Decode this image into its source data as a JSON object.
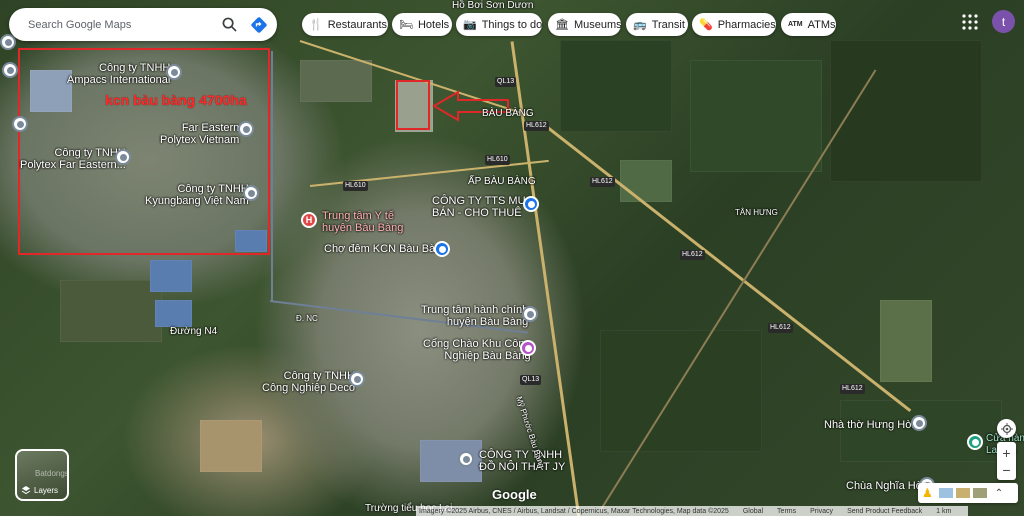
{
  "search": {
    "placeholder": "Search Google Maps"
  },
  "chips": [
    {
      "label": "Restaurants",
      "icon": "fork-knife-icon",
      "glyph": "🍴"
    },
    {
      "label": "Hotels",
      "icon": "bed-icon",
      "glyph": "🛏"
    },
    {
      "label": "Things to do",
      "icon": "camera-icon",
      "glyph": "📷"
    },
    {
      "label": "Museums",
      "icon": "museum-icon",
      "glyph": "🏛"
    },
    {
      "label": "Transit",
      "icon": "bus-icon",
      "glyph": "🚌"
    },
    {
      "label": "Pharmacies",
      "icon": "pill-icon",
      "glyph": "💊"
    },
    {
      "label": "ATMs",
      "icon": "atm-icon",
      "glyph": "ATM"
    }
  ],
  "account": {
    "initial": "t"
  },
  "annotation": {
    "text": "kcn bàu bàng 4700ha",
    "color": "#e02828"
  },
  "places": {
    "ampacs": "Công ty TNHH\nAmpacs International",
    "fareastern": "Far Eastern\nPolytex Vietnam",
    "polytex": "Công ty TNHH\nPolytex Far Eastern...",
    "kyungbang": "Công ty TNHH\nKyungbang Việt Nam",
    "hospital": "Trung tâm Y tế\nhuyện Bàu Bàng",
    "market": "Chợ đêm KCN Bàu Bàng",
    "tts": "CÔNG TY TTS MUA\nBÁN - CHO THUÊ",
    "baubang": "BÀU BÀNG",
    "apbaubang": "ẤP BÀU BÀNG",
    "tanhung": "TÂN HƯNG",
    "admin": "Trung tâm hành chính\nhuyện Bàu Bàng",
    "gate": "Cổng Chào Khu Công\nNghiệp Bàu Bàng",
    "deco": "Công ty TNHH\nCông Nghiệp Deco",
    "furniture": "CÔNG TY TNHH\nĐỒ NỘI THẤT JY",
    "church": "Nhà thờ Hưng Hòa",
    "pagoda": "Chùa Nghĩa Hòa",
    "school": "Trường tiểu học Lai...",
    "top": "Hồ Bơi Sơn Dươn",
    "road_n4": "Đường N4",
    "road_nc": "Đ. NC",
    "road_phuoc": "Mỹ Phước Bàu Bàng",
    "right_edge": "Cửa hàng\nLa Vi..."
  },
  "highways": {
    "ql13_top": "QL13",
    "ql13_bot": "QL13",
    "hl612_a": "HL612",
    "hl612_b": "HL612",
    "hl612_c": "HL612",
    "hl612_d": "HL612",
    "hl610_a": "HL610",
    "hl610_b": "HL610"
  },
  "layers": {
    "label": "Layers"
  },
  "watermark": "Batdongsan",
  "attribution": {
    "imagery": "Imagery ©2025 Airbus, CNES / Airbus, Landsat / Copernicus, Maxar Technologies, Map data ©2025",
    "global": "Global",
    "terms": "Terms",
    "privacy": "Privacy",
    "feedback": "Send Product Feedback",
    "scale": "1 km"
  },
  "google_logo": "Google"
}
